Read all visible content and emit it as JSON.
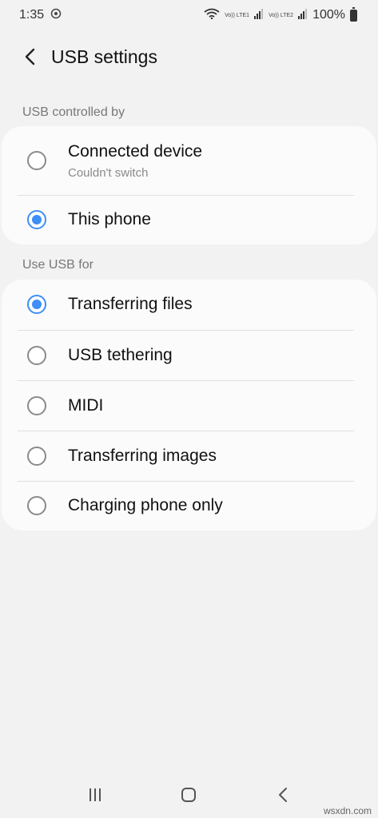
{
  "status_bar": {
    "time": "1:35",
    "sim1": "Vo)) LTE1",
    "sim2": "Vo)) LTE2",
    "battery_pct": "100%"
  },
  "header": {
    "title": "USB settings"
  },
  "controlled_by": {
    "label": "USB controlled by",
    "options": [
      {
        "label": "Connected device",
        "sub": "Couldn't switch",
        "checked": false
      },
      {
        "label": "This phone",
        "checked": true
      }
    ]
  },
  "use_for": {
    "label": "Use USB for",
    "options": [
      {
        "label": "Transferring files",
        "checked": true
      },
      {
        "label": "USB tethering",
        "checked": false
      },
      {
        "label": "MIDI",
        "checked": false
      },
      {
        "label": "Transferring images",
        "checked": false
      },
      {
        "label": "Charging phone only",
        "checked": false
      }
    ]
  },
  "colors": {
    "accent": "#3e8ef7",
    "background": "#f2f2f2",
    "card": "#fbfbfb"
  },
  "watermark": "wsxdn.com"
}
